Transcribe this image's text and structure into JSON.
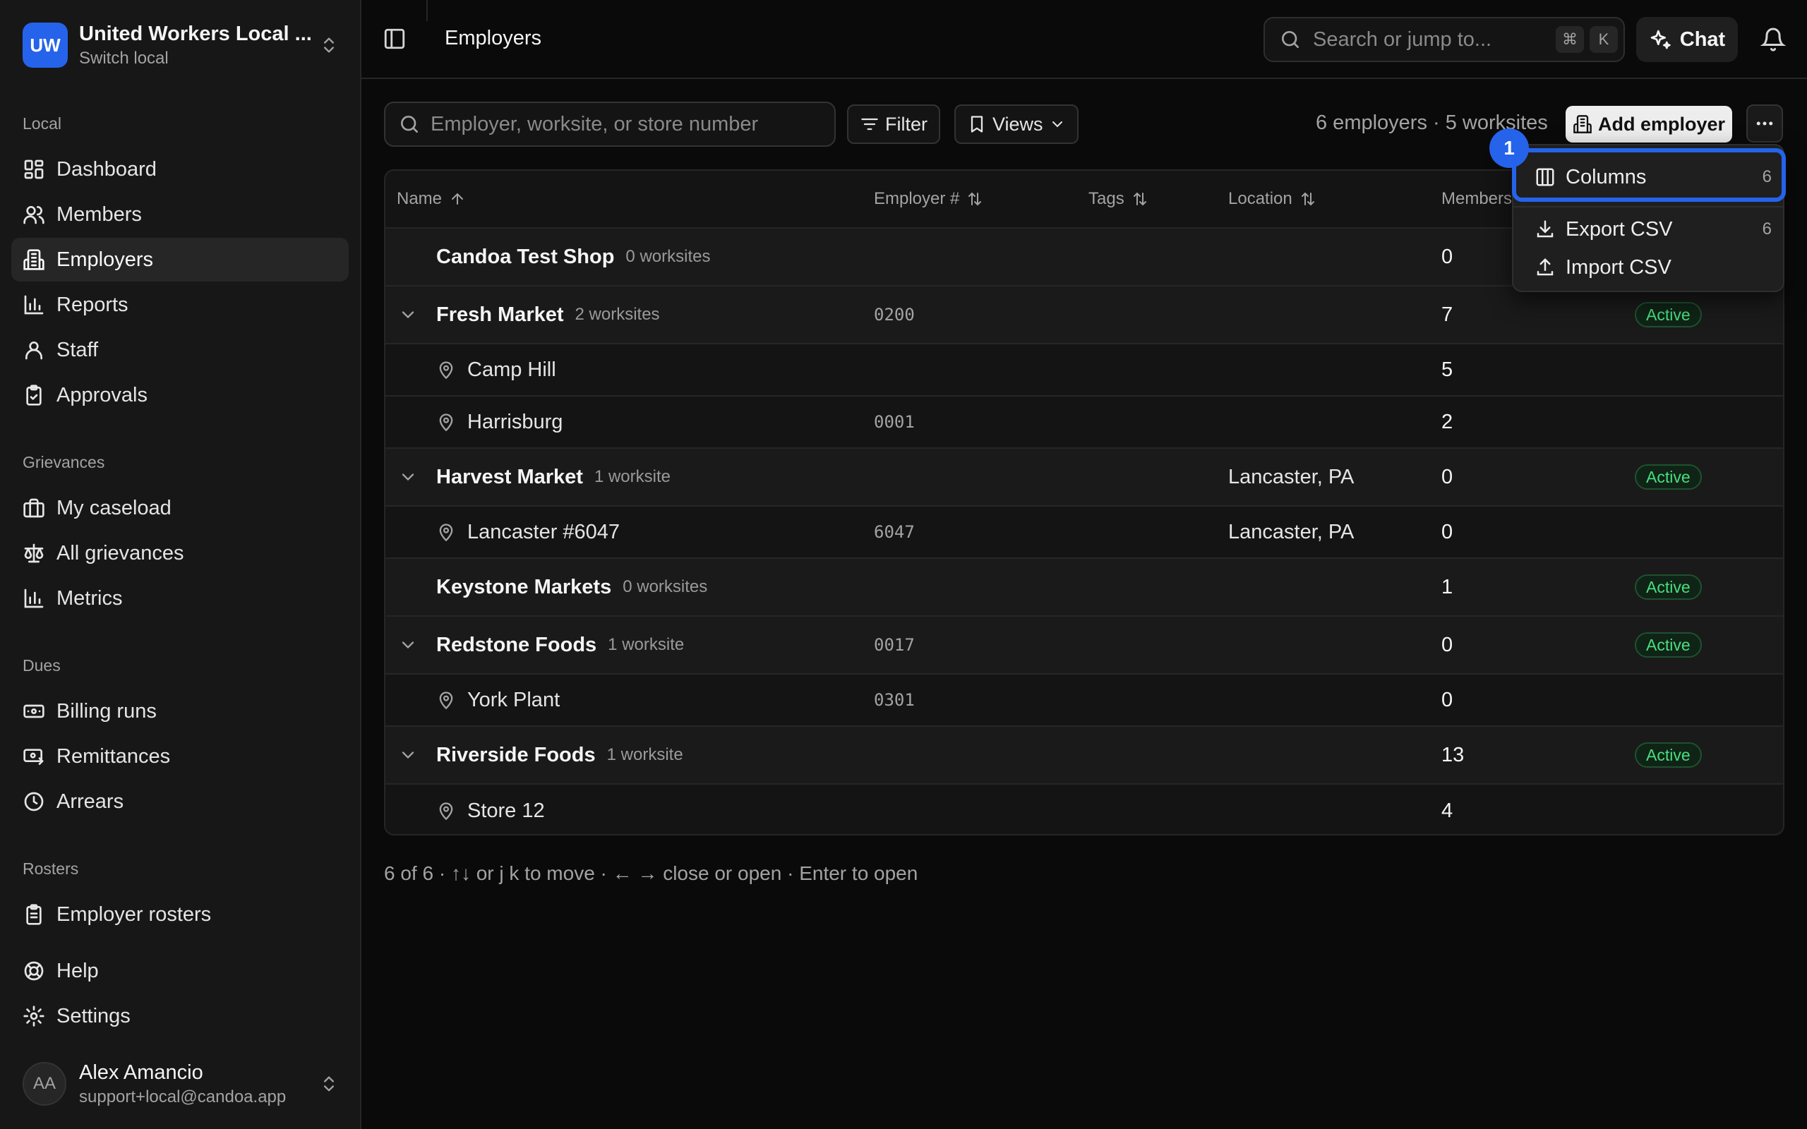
{
  "org": {
    "initials": "UW",
    "name": "United Workers Local ...",
    "switch_label": "Switch local"
  },
  "sidebar": {
    "sections": {
      "local": "Local",
      "grievances": "Grievances",
      "dues": "Dues",
      "rosters": "Rosters"
    },
    "items": {
      "dashboard": "Dashboard",
      "members": "Members",
      "employers": "Employers",
      "reports": "Reports",
      "staff": "Staff",
      "approvals": "Approvals",
      "my_caseload": "My caseload",
      "all_grievances": "All grievances",
      "metrics": "Metrics",
      "billing_runs": "Billing runs",
      "remittances": "Remittances",
      "arrears": "Arrears",
      "employer_rosters": "Employer rosters",
      "help": "Help",
      "settings": "Settings"
    },
    "active_item": "employers"
  },
  "user": {
    "initials": "AA",
    "name": "Alex Amancio",
    "email": "support+local@candoa.app"
  },
  "header": {
    "title": "Employers",
    "search_placeholder": "Search or jump to...",
    "kbd_cmd": "⌘",
    "kbd_k": "K",
    "chat_label": "Chat"
  },
  "toolbar": {
    "filter_placeholder": "Employer, worksite, or store number",
    "filter_label": "Filter",
    "views_label": "Views",
    "counts": "6 employers · 5 worksites",
    "add_label": "Add employer"
  },
  "table": {
    "columns": {
      "name": "Name",
      "employer_num": "Employer #",
      "tags": "Tags",
      "location": "Location",
      "members": "Members"
    },
    "rows": [
      {
        "type": "group",
        "name": "Candoa Test Shop",
        "worksites": "0 worksites",
        "expandable": false,
        "employer_num": "",
        "location": "",
        "members": "0",
        "status": ""
      },
      {
        "type": "group",
        "name": "Fresh Market",
        "worksites": "2 worksites",
        "expandable": true,
        "employer_num": "0200",
        "location": "",
        "members": "7",
        "status": "Active"
      },
      {
        "type": "site",
        "name": "Camp Hill",
        "employer_num": "",
        "location": "",
        "members": "5"
      },
      {
        "type": "site",
        "name": "Harrisburg",
        "employer_num": "0001",
        "location": "",
        "members": "2"
      },
      {
        "type": "group",
        "name": "Harvest Market",
        "worksites": "1 worksite",
        "expandable": true,
        "employer_num": "",
        "location": "Lancaster, PA",
        "members": "0",
        "status": "Active"
      },
      {
        "type": "site",
        "name": "Lancaster #6047",
        "employer_num": "6047",
        "location": "Lancaster, PA",
        "members": "0"
      },
      {
        "type": "group",
        "name": "Keystone Markets",
        "worksites": "0 worksites",
        "expandable": false,
        "employer_num": "",
        "location": "",
        "members": "1",
        "status": "Active"
      },
      {
        "type": "group",
        "name": "Redstone Foods",
        "worksites": "1 worksite",
        "expandable": true,
        "employer_num": "0017",
        "location": "",
        "members": "0",
        "status": "Active"
      },
      {
        "type": "site",
        "name": "York Plant",
        "employer_num": "0301",
        "location": "",
        "members": "0"
      },
      {
        "type": "group",
        "name": "Riverside Foods",
        "worksites": "1 worksite",
        "expandable": true,
        "employer_num": "",
        "location": "",
        "members": "13",
        "status": "Active"
      },
      {
        "type": "site",
        "name": "Store 12",
        "employer_num": "",
        "location": "",
        "members": "4"
      }
    ]
  },
  "footer_hint": "6 of 6 · ↑↓ or j k to move · ← → close or open · Enter to open",
  "menu": {
    "columns_label": "Columns",
    "columns_count": "6",
    "export_label": "Export CSV",
    "export_count": "6",
    "import_label": "Import CSV"
  },
  "annotation": {
    "step": "1"
  },
  "colors": {
    "accent": "#2563eb",
    "active_badge": "#4ade80"
  }
}
